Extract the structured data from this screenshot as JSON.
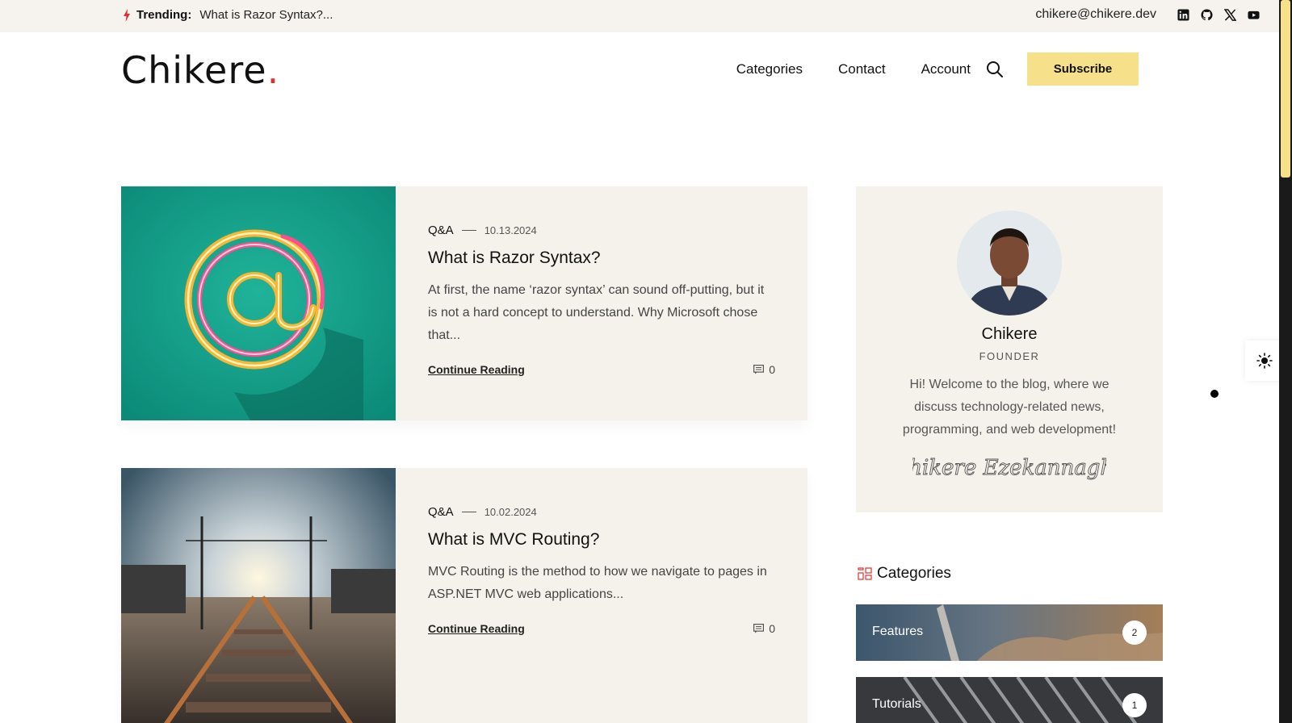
{
  "topbar": {
    "trending_label": "Trending:",
    "trending_text": "What is Razor Syntax?...",
    "email": "chikere@chikere.dev",
    "social": [
      "linkedin-icon",
      "github-icon",
      "x-icon",
      "youtube-icon"
    ]
  },
  "header": {
    "logo_text": "Chikere",
    "logo_dot": ".",
    "nav": [
      "Categories",
      "Contact",
      "Account"
    ],
    "subscribe_label": "Subscribe"
  },
  "posts": [
    {
      "category": "Q&A",
      "date": "10.13.2024",
      "title": "What is Razor Syntax?",
      "excerpt": "At first, the name ‘razor syntax’ can sound off-putting, but it is not a hard concept to understand. Why Microsoft chose that...",
      "read_label": "Continue Reading",
      "comments": "0",
      "image": "neon-at-sign"
    },
    {
      "category": "Q&A",
      "date": "10.02.2024",
      "title": "What is MVC Routing?",
      "excerpt": "MVC Routing is the method to how we navigate to pages in ASP.NET MVC web applications...",
      "read_label": "Continue Reading",
      "comments": "0",
      "image": "railway-tracks"
    }
  ],
  "author": {
    "name": "Chikere",
    "role": "FOUNDER",
    "bio": "Hi! Welcome to the blog, where we discuss technology-related news, programming, and web development!",
    "signature": "Chikere Ezekannagha"
  },
  "categories": {
    "heading": "Categories",
    "items": [
      {
        "label": "Features",
        "count": "2"
      },
      {
        "label": "Tutorials",
        "count": "1"
      }
    ]
  },
  "colors": {
    "accent": "#f7e08a",
    "logo_dot": "#e0302e",
    "card_bg": "#f5f2ec",
    "topbar_bg": "#f6f3ee"
  }
}
